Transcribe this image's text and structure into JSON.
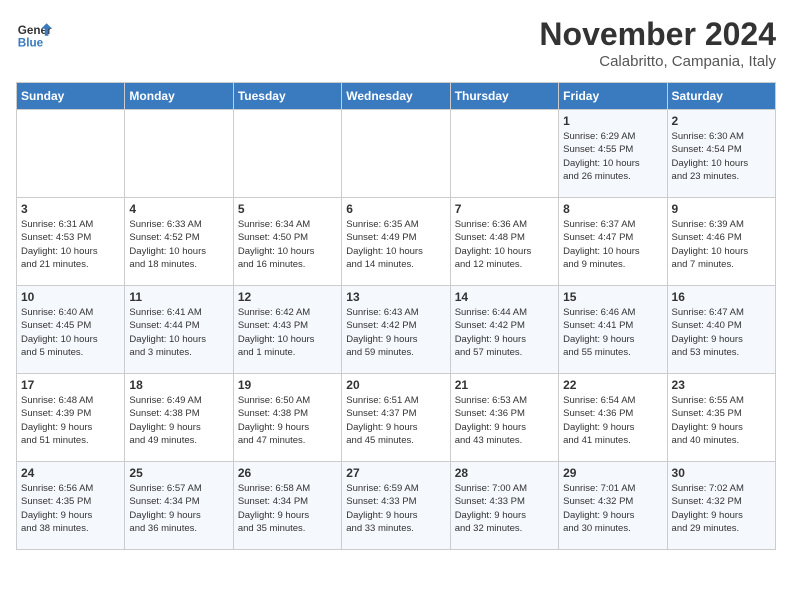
{
  "header": {
    "logo_line1": "General",
    "logo_line2": "Blue",
    "month": "November 2024",
    "location": "Calabritto, Campania, Italy"
  },
  "weekdays": [
    "Sunday",
    "Monday",
    "Tuesday",
    "Wednesday",
    "Thursday",
    "Friday",
    "Saturday"
  ],
  "weeks": [
    [
      {
        "day": "",
        "info": ""
      },
      {
        "day": "",
        "info": ""
      },
      {
        "day": "",
        "info": ""
      },
      {
        "day": "",
        "info": ""
      },
      {
        "day": "",
        "info": ""
      },
      {
        "day": "1",
        "info": "Sunrise: 6:29 AM\nSunset: 4:55 PM\nDaylight: 10 hours\nand 26 minutes."
      },
      {
        "day": "2",
        "info": "Sunrise: 6:30 AM\nSunset: 4:54 PM\nDaylight: 10 hours\nand 23 minutes."
      }
    ],
    [
      {
        "day": "3",
        "info": "Sunrise: 6:31 AM\nSunset: 4:53 PM\nDaylight: 10 hours\nand 21 minutes."
      },
      {
        "day": "4",
        "info": "Sunrise: 6:33 AM\nSunset: 4:52 PM\nDaylight: 10 hours\nand 18 minutes."
      },
      {
        "day": "5",
        "info": "Sunrise: 6:34 AM\nSunset: 4:50 PM\nDaylight: 10 hours\nand 16 minutes."
      },
      {
        "day": "6",
        "info": "Sunrise: 6:35 AM\nSunset: 4:49 PM\nDaylight: 10 hours\nand 14 minutes."
      },
      {
        "day": "7",
        "info": "Sunrise: 6:36 AM\nSunset: 4:48 PM\nDaylight: 10 hours\nand 12 minutes."
      },
      {
        "day": "8",
        "info": "Sunrise: 6:37 AM\nSunset: 4:47 PM\nDaylight: 10 hours\nand 9 minutes."
      },
      {
        "day": "9",
        "info": "Sunrise: 6:39 AM\nSunset: 4:46 PM\nDaylight: 10 hours\nand 7 minutes."
      }
    ],
    [
      {
        "day": "10",
        "info": "Sunrise: 6:40 AM\nSunset: 4:45 PM\nDaylight: 10 hours\nand 5 minutes."
      },
      {
        "day": "11",
        "info": "Sunrise: 6:41 AM\nSunset: 4:44 PM\nDaylight: 10 hours\nand 3 minutes."
      },
      {
        "day": "12",
        "info": "Sunrise: 6:42 AM\nSunset: 4:43 PM\nDaylight: 10 hours\nand 1 minute."
      },
      {
        "day": "13",
        "info": "Sunrise: 6:43 AM\nSunset: 4:42 PM\nDaylight: 9 hours\nand 59 minutes."
      },
      {
        "day": "14",
        "info": "Sunrise: 6:44 AM\nSunset: 4:42 PM\nDaylight: 9 hours\nand 57 minutes."
      },
      {
        "day": "15",
        "info": "Sunrise: 6:46 AM\nSunset: 4:41 PM\nDaylight: 9 hours\nand 55 minutes."
      },
      {
        "day": "16",
        "info": "Sunrise: 6:47 AM\nSunset: 4:40 PM\nDaylight: 9 hours\nand 53 minutes."
      }
    ],
    [
      {
        "day": "17",
        "info": "Sunrise: 6:48 AM\nSunset: 4:39 PM\nDaylight: 9 hours\nand 51 minutes."
      },
      {
        "day": "18",
        "info": "Sunrise: 6:49 AM\nSunset: 4:38 PM\nDaylight: 9 hours\nand 49 minutes."
      },
      {
        "day": "19",
        "info": "Sunrise: 6:50 AM\nSunset: 4:38 PM\nDaylight: 9 hours\nand 47 minutes."
      },
      {
        "day": "20",
        "info": "Sunrise: 6:51 AM\nSunset: 4:37 PM\nDaylight: 9 hours\nand 45 minutes."
      },
      {
        "day": "21",
        "info": "Sunrise: 6:53 AM\nSunset: 4:36 PM\nDaylight: 9 hours\nand 43 minutes."
      },
      {
        "day": "22",
        "info": "Sunrise: 6:54 AM\nSunset: 4:36 PM\nDaylight: 9 hours\nand 41 minutes."
      },
      {
        "day": "23",
        "info": "Sunrise: 6:55 AM\nSunset: 4:35 PM\nDaylight: 9 hours\nand 40 minutes."
      }
    ],
    [
      {
        "day": "24",
        "info": "Sunrise: 6:56 AM\nSunset: 4:35 PM\nDaylight: 9 hours\nand 38 minutes."
      },
      {
        "day": "25",
        "info": "Sunrise: 6:57 AM\nSunset: 4:34 PM\nDaylight: 9 hours\nand 36 minutes."
      },
      {
        "day": "26",
        "info": "Sunrise: 6:58 AM\nSunset: 4:34 PM\nDaylight: 9 hours\nand 35 minutes."
      },
      {
        "day": "27",
        "info": "Sunrise: 6:59 AM\nSunset: 4:33 PM\nDaylight: 9 hours\nand 33 minutes."
      },
      {
        "day": "28",
        "info": "Sunrise: 7:00 AM\nSunset: 4:33 PM\nDaylight: 9 hours\nand 32 minutes."
      },
      {
        "day": "29",
        "info": "Sunrise: 7:01 AM\nSunset: 4:32 PM\nDaylight: 9 hours\nand 30 minutes."
      },
      {
        "day": "30",
        "info": "Sunrise: 7:02 AM\nSunset: 4:32 PM\nDaylight: 9 hours\nand 29 minutes."
      }
    ]
  ]
}
